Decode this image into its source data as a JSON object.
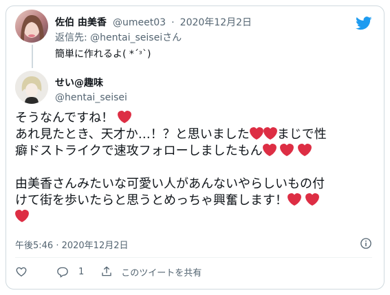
{
  "parent": {
    "name": "佐伯 由美香",
    "handle": "@umeet03",
    "separator": "·",
    "date": "2020年12月2日",
    "reply_label": "返信先: ",
    "reply_handle": "@hentai_seiseiさん",
    "text": "簡単に作れるよ( *´ᵌ`)"
  },
  "tweet": {
    "name": "せい@趣味",
    "handle": "@hentai_seisei",
    "lines": [
      "そうなんですね！",
      "あれ見たとき、天才か…！？と思いました",
      "まじで性",
      "癖ドストライクで速攻フォローしましたもん",
      "由美香さんみたいな可愛い人があんないやらしいもの付",
      "けて街を歩いたらと思うとめっちゃ興奮します！"
    ],
    "timestamp": "午後5:46 · 2020年12月2日"
  },
  "actions": {
    "reply_count": "1",
    "share_label": "このツイートを共有"
  },
  "colors": {
    "twitter_blue": "#1d9bf0",
    "heart_red": "#dd2e44",
    "secondary_text": "#536471"
  },
  "icons": [
    "twitter-bird-icon",
    "heart-icon",
    "info-icon",
    "like-icon",
    "reply-icon",
    "share-icon"
  ]
}
